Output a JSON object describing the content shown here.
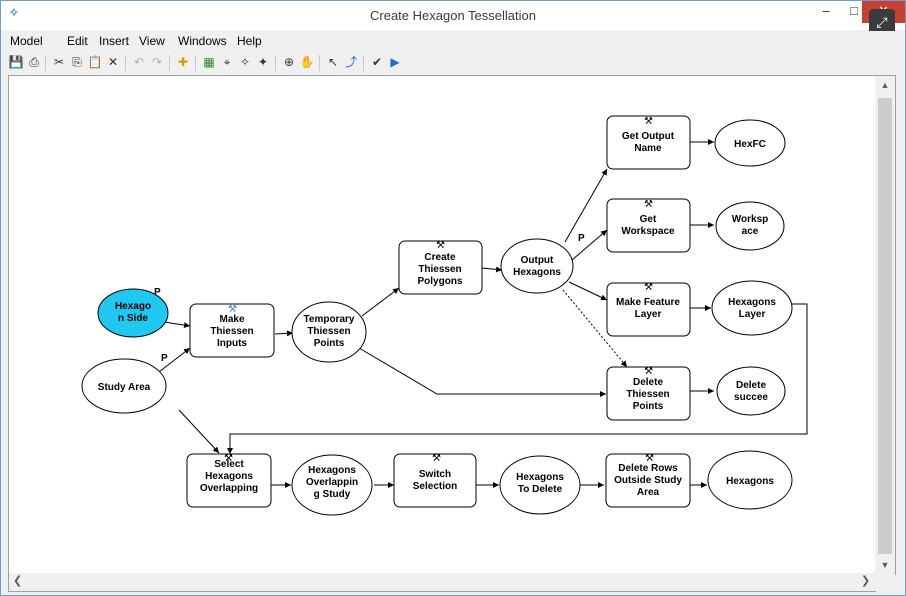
{
  "window": {
    "title": "Create Hexagon Tessellation"
  },
  "menu": [
    "Model",
    "Edit",
    "Insert",
    "View",
    "Windows",
    "Help"
  ],
  "colors": {
    "param_fill": "#1ec8f0",
    "node_fill": "#ffffff",
    "accent": "#1e6bd6"
  },
  "toolbar_icons": [
    "save-icon",
    "print-icon",
    "cut-icon",
    "copy-icon",
    "paste-icon",
    "delete-icon",
    "undo-icon",
    "redo-icon",
    "add-data-icon",
    "auto-layout-icon",
    "full-extent-icon",
    "zoom-in-fixed-icon",
    "zoom-out-fixed-icon",
    "zoom-in-icon",
    "pan-icon",
    "select-icon",
    "connect-icon",
    "validate-icon",
    "run-icon"
  ],
  "nodes": {
    "hexagon_side": {
      "line1": "Hexago",
      "line2": "n Side"
    },
    "study_area": {
      "line1": "Study Area"
    },
    "make_thiessen_inputs": {
      "line1": "Make",
      "line2": "Thiessen",
      "line3": "Inputs"
    },
    "temporary_thiessen_points": {
      "line1": "Temporary",
      "line2": "Thiessen",
      "line3": "Points"
    },
    "create_thiessen_polygons": {
      "line1": "Create",
      "line2": "Thiessen",
      "line3": "Polygons"
    },
    "output_hexagons": {
      "line1": "Output",
      "line2": "Hexagons"
    },
    "get_output_name": {
      "line1": "Get Output",
      "line2": "Name"
    },
    "hexfc": {
      "line1": "HexFC"
    },
    "get_workspace": {
      "line1": "Get",
      "line2": "Workspace"
    },
    "workspace": {
      "line1": "Worksp",
      "line2": "ace"
    },
    "make_feature_layer": {
      "line1": "Make Feature",
      "line2": "Layer"
    },
    "hexagons_layer": {
      "line1": "Hexagons",
      "line2": "Layer"
    },
    "delete_thiessen_points": {
      "line1": "Delete",
      "line2": "Thiessen",
      "line3": "Points"
    },
    "delete_succeeded": {
      "line1": "Delete",
      "line2": "succee"
    },
    "select_hexagons_overlapping": {
      "line1": "Select",
      "line2": "Hexagons",
      "line3": "Overlapping"
    },
    "hexagons_overlapping_study": {
      "line1": "Hexagons",
      "line2": "Overlappin",
      "line3": "g Study"
    },
    "switch_selection": {
      "line1": "Switch",
      "line2": "Selection"
    },
    "hexagons_to_delete": {
      "line1": "Hexagons",
      "line2": "To Delete"
    },
    "delete_rows_outside": {
      "line1": "Delete Rows",
      "line2": "Outside Study",
      "line3": "Area"
    },
    "hexagons": {
      "line1": "Hexagons"
    }
  },
  "param_markers": {
    "p1": "P",
    "p2": "P",
    "p3": "P"
  }
}
